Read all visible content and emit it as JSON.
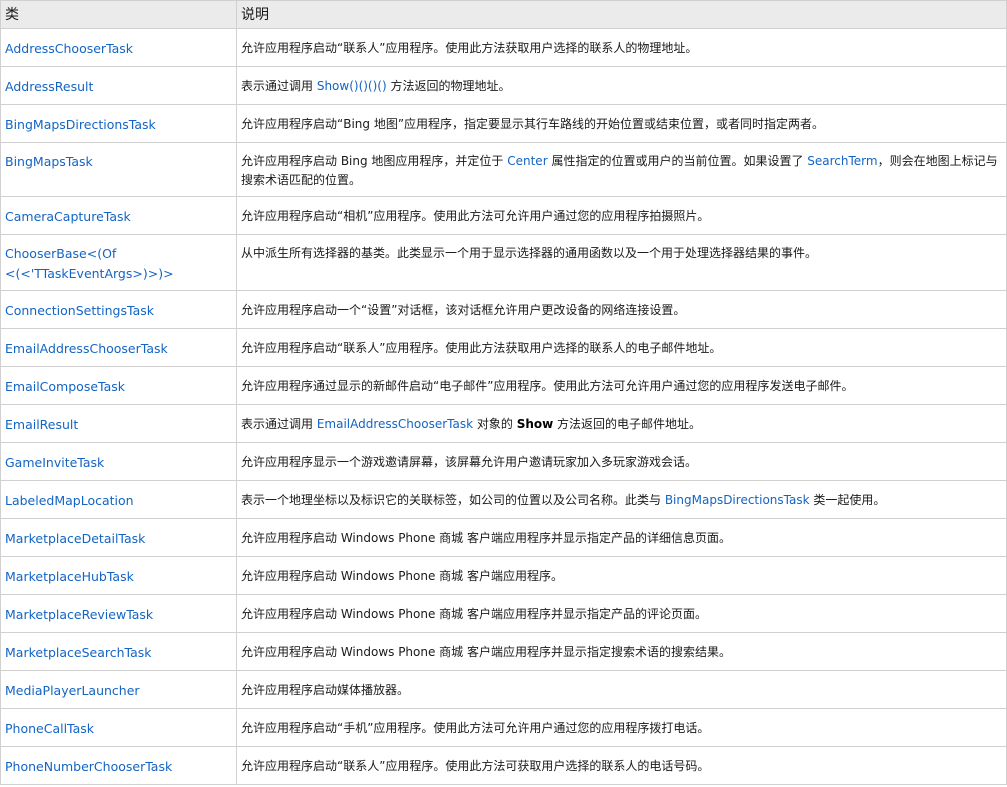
{
  "table": {
    "headers": [
      "类",
      "说明"
    ],
    "rows": [
      {
        "name": "AddressChooserTask",
        "desc": [
          {
            "t": "允许应用程序启动“联系人”应用程序。使用此方法获取用户选择的联系人的物理地址。"
          }
        ]
      },
      {
        "name": "AddressResult",
        "desc": [
          {
            "t": "表示通过调用 "
          },
          {
            "t": "Show()()()()",
            "link": true
          },
          {
            "t": " 方法返回的物理地址。"
          }
        ]
      },
      {
        "name": "BingMapsDirectionsTask",
        "desc": [
          {
            "t": "允许应用程序启动“Bing 地图”应用程序，指定要显示其行车路线的开始位置或结束位置，或者同时指定两者。"
          }
        ]
      },
      {
        "name": "BingMapsTask",
        "desc": [
          {
            "t": "允许应用程序启动 Bing 地图应用程序，并定位于 "
          },
          {
            "t": "Center",
            "link": true
          },
          {
            "t": " 属性指定的位置或用户的当前位置。如果设置了 "
          },
          {
            "t": "SearchTerm",
            "link": true
          },
          {
            "t": "，则会在地图上标记与搜索术语匹配的位置。"
          }
        ]
      },
      {
        "name": "CameraCaptureTask",
        "desc": [
          {
            "t": "允许应用程序启动“相机”应用程序。使用此方法可允许用户通过您的应用程序拍摄照片。"
          }
        ]
      },
      {
        "name": "ChooserBase<(Of <(<'TTaskEventArgs>)>)>",
        "desc": [
          {
            "t": "从中派生所有选择器的基类。此类显示一个用于显示选择器的通用函数以及一个用于处理选择器结果的事件。"
          }
        ]
      },
      {
        "name": "ConnectionSettingsTask",
        "desc": [
          {
            "t": "允许应用程序启动一个“设置”对话框，该对话框允许用户更改设备的网络连接设置。"
          }
        ]
      },
      {
        "name": "EmailAddressChooserTask",
        "desc": [
          {
            "t": "允许应用程序启动“联系人”应用程序。使用此方法获取用户选择的联系人的电子邮件地址。"
          }
        ]
      },
      {
        "name": "EmailComposeTask",
        "desc": [
          {
            "t": "允许应用程序通过显示的新邮件启动“电子邮件”应用程序。使用此方法可允许用户通过您的应用程序发送电子邮件。"
          }
        ]
      },
      {
        "name": "EmailResult",
        "desc": [
          {
            "t": "表示通过调用 "
          },
          {
            "t": "EmailAddressChooserTask",
            "link": true
          },
          {
            "t": " 对象的 "
          },
          {
            "t": "Show",
            "bold": true
          },
          {
            "t": " 方法返回的电子邮件地址。"
          }
        ]
      },
      {
        "name": "GameInviteTask",
        "desc": [
          {
            "t": "允许应用程序显示一个游戏邀请屏幕，该屏幕允许用户邀请玩家加入多玩家游戏会话。"
          }
        ]
      },
      {
        "name": "LabeledMapLocation",
        "desc": [
          {
            "t": "表示一个地理坐标以及标识它的关联标签，如公司的位置以及公司名称。此类与 "
          },
          {
            "t": "BingMapsDirectionsTask",
            "link": true
          },
          {
            "t": " 类一起使用。"
          }
        ]
      },
      {
        "name": "MarketplaceDetailTask",
        "desc": [
          {
            "t": "允许应用程序启动 Windows Phone 商城 客户端应用程序并显示指定产品的详细信息页面。"
          }
        ]
      },
      {
        "name": "MarketplaceHubTask",
        "desc": [
          {
            "t": "允许应用程序启动 Windows Phone 商城 客户端应用程序。"
          }
        ]
      },
      {
        "name": "MarketplaceReviewTask",
        "desc": [
          {
            "t": "允许应用程序启动 Windows Phone 商城 客户端应用程序并显示指定产品的评论页面。"
          }
        ]
      },
      {
        "name": "MarketplaceSearchTask",
        "desc": [
          {
            "t": "允许应用程序启动 Windows Phone 商城 客户端应用程序并显示指定搜索术语的搜索结果。"
          }
        ]
      },
      {
        "name": "MediaPlayerLauncher",
        "desc": [
          {
            "t": "允许应用程序启动媒体播放器。"
          }
        ]
      },
      {
        "name": "PhoneCallTask",
        "desc": [
          {
            "t": "允许应用程序启动“手机”应用程序。使用此方法可允许用户通过您的应用程序拨打电话。"
          }
        ]
      },
      {
        "name": "PhoneNumberChooserTask",
        "desc": [
          {
            "t": "允许应用程序启动“联系人”应用程序。使用此方法可获取用户选择的联系人的电话号码。"
          }
        ]
      }
    ]
  }
}
